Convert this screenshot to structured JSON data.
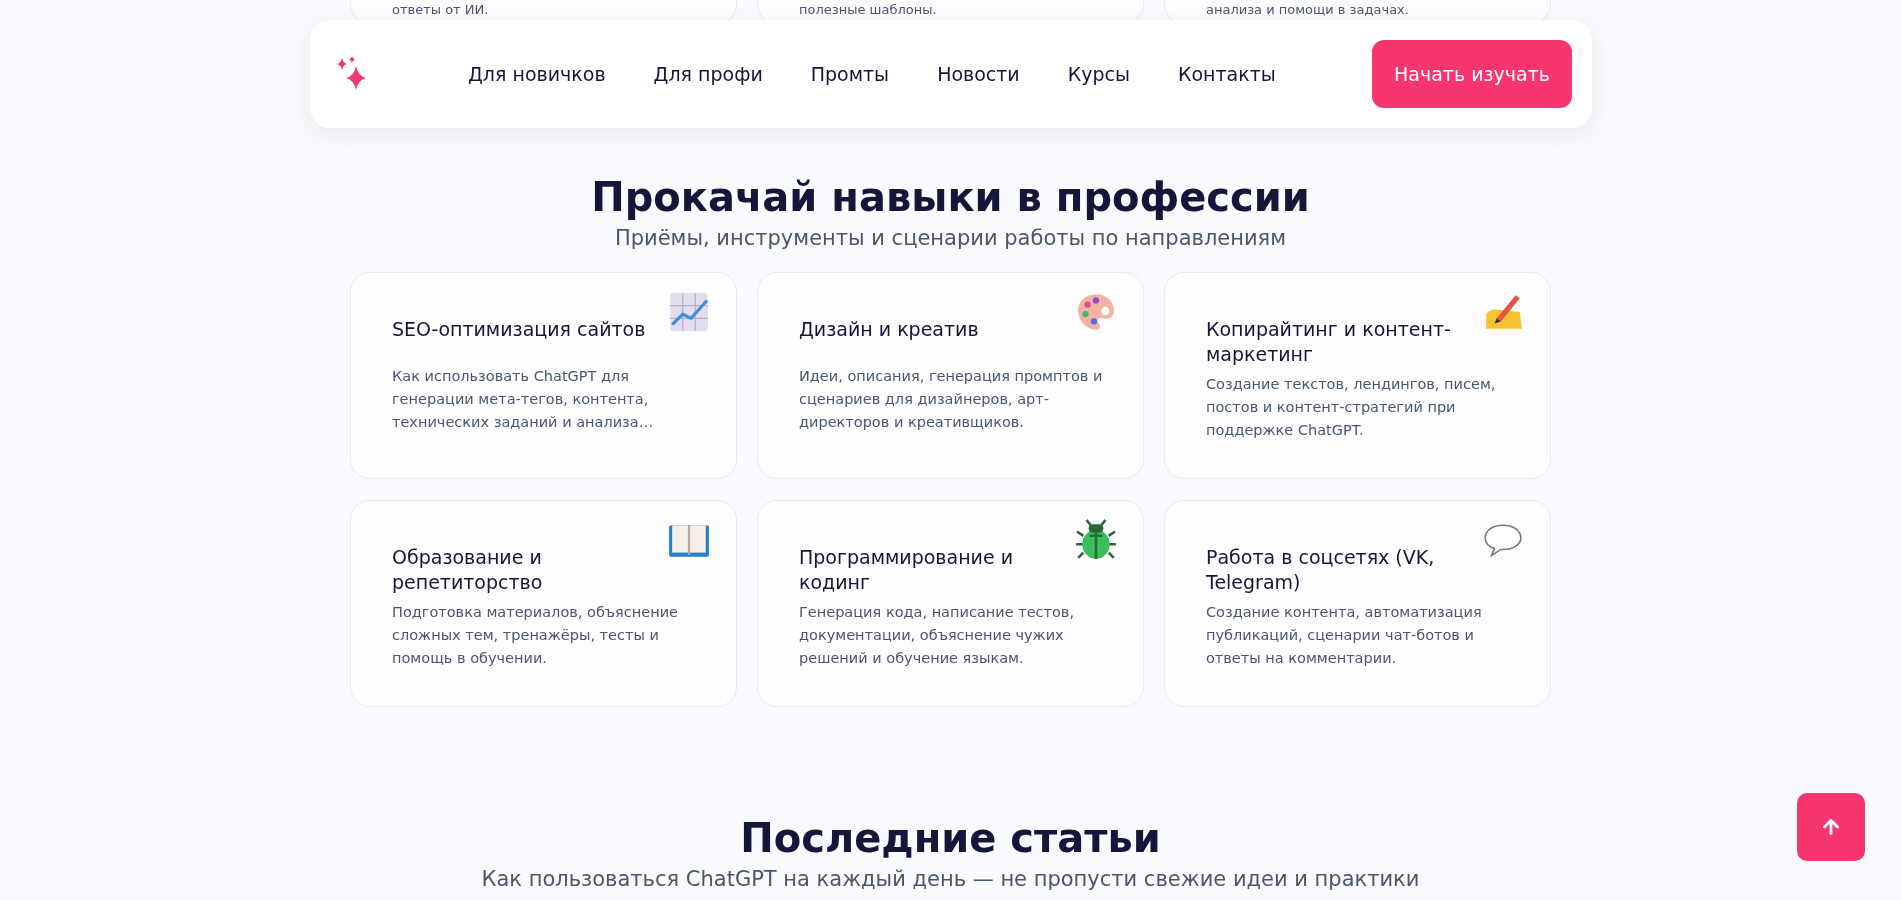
{
  "top_cards": [
    "ответы от ИИ.",
    "полезные шаблоны.",
    "анализа и помощи в задачах."
  ],
  "nav": {
    "links": [
      "Для новичков",
      "Для профи",
      "Промты",
      "Новости",
      "Курсы",
      "Контакты"
    ],
    "cta": "Начать изучать"
  },
  "skills": {
    "title": "Прокачай навыки в профессии",
    "subtitle": "Приёмы, инструменты и сценарии работы по направлениям",
    "cards": [
      {
        "kind": "chart",
        "title": "SEO-оптимизация сайтов",
        "text": "Как использовать ChatGPT для генерации мета-тегов, контента, технических заданий и анализа…"
      },
      {
        "kind": "palette",
        "title": "Дизайн и креатив",
        "text": "Идеи, описания, генерация промптов и сценариев для дизайнеров, арт-директоров и креативщиков."
      },
      {
        "kind": "writing",
        "title": "Копирайтинг и контент-маркетинг",
        "text": "Создание текстов, лендингов, писем, постов и контент-стратегий при поддержке ChatGPT."
      },
      {
        "kind": "book",
        "title": "Образование и репетиторство",
        "text": "Подготовка материалов, объяснение сложных тем, тренажёры, тесты и помощь в обучении."
      },
      {
        "kind": "bug",
        "title": "Программирование и кодинг",
        "text": "Генерация кода, написание тестов, документации, объяснение чужих решений и обучение языкам."
      },
      {
        "kind": "bubble",
        "title": "Работа в соцсетях (VK, Telegram)",
        "text": "Создание контента, автоматизация публикаций, сценарии чат-ботов и ответы на комментарии."
      }
    ]
  },
  "articles": {
    "title": "Последние статьи",
    "subtitle": "Как пользоваться ChatGPT на каждый день — не пропусти свежие идеи и практики"
  }
}
